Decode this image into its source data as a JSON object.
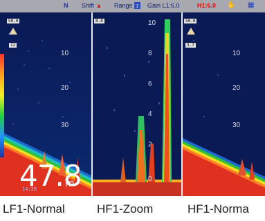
{
  "status": {
    "mode": "N",
    "shift": "Shift",
    "range": "Range",
    "gain": "Gain L1:6.0",
    "hf_gain": "H1:6.0"
  },
  "panes": [
    {
      "id": "left",
      "tag": "50.0",
      "sub": "12",
      "scale": [
        "10",
        "20",
        "30"
      ],
      "name": "LF1-Normal"
    },
    {
      "id": "mid",
      "tag": "8.0",
      "scale": [
        "10",
        "8",
        "6",
        "4",
        "2",
        "0"
      ],
      "name": "HF1-Zoom"
    },
    {
      "id": "right",
      "tag": "50.0",
      "sub": "3.7",
      "scale": [
        "10",
        "20",
        "30"
      ],
      "name": "HF1-Norma"
    }
  ],
  "depth": {
    "value": "47.8",
    "unit": "m",
    "sub": "14:28"
  },
  "labels": {
    "left": "LF1-Normal",
    "mid": "HF1-Zoom",
    "right": "HF1-Norma"
  }
}
